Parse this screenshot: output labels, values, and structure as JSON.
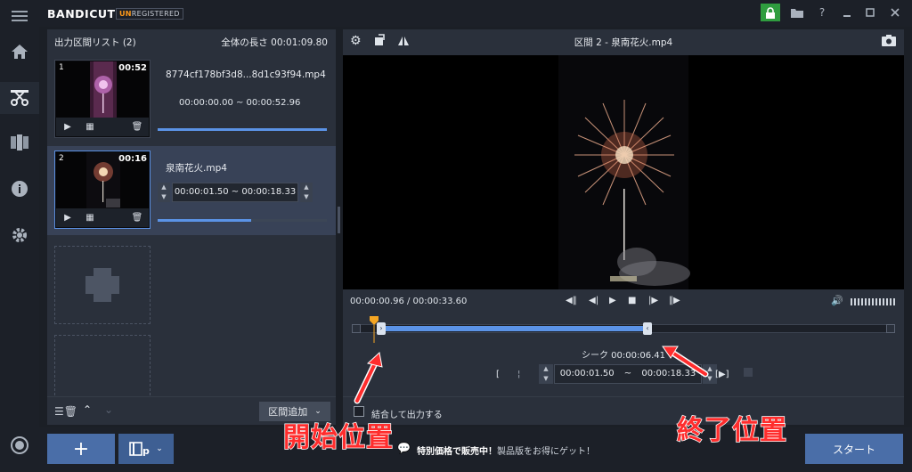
{
  "app": {
    "logo": "BANDICUT",
    "badge_prefix": "UN",
    "badge_rest": "REGISTERED",
    "window_help": "?"
  },
  "colors": {
    "accent": "#5b93e6",
    "annotation": "#ff2d2d",
    "lock_green": "#2f9d3f",
    "start_button": "#4a6ea8"
  },
  "list_panel": {
    "title": "出力区間リスト (2)",
    "total_length": "全体の長さ 00:01:09.80",
    "clips": [
      {
        "number": "1",
        "duration": "00:52",
        "filename": "8774cf178bf3d8...8d1c93f94.mp4",
        "range": "00:00:00.00 ~ 00:00:52.96",
        "progress": 1.0
      },
      {
        "number": "2",
        "duration": "00:16",
        "filename": "泉南花火.mp4",
        "range": "00:00:01.50 ~ 00:00:18.33",
        "progress": 0.55
      }
    ],
    "add_section_button": "区間追加"
  },
  "player": {
    "title": "区間 2 - 泉南花火.mp4",
    "position": "00:00:00.96 / 00:00:33.60",
    "seek_label": "シーク 00:00:06.41",
    "range_start": "00:00:01.50",
    "range_sep": "~",
    "range_end": "00:00:18.33",
    "bracket_open": "[",
    "play_selection": "[▶]",
    "merge_label": "結合して出力する",
    "selection_start_fraction": 0.052,
    "selection_end_fraction": 0.545,
    "playhead_fraction": 0.039
  },
  "bottom": {
    "add_button": "+",
    "promo_bold": "特別価格で販売中！",
    "promo_rest": "製品版をお得にゲット！",
    "start_button": "スタート"
  },
  "annotations": {
    "start": "開始位置",
    "end": "終了位置"
  }
}
